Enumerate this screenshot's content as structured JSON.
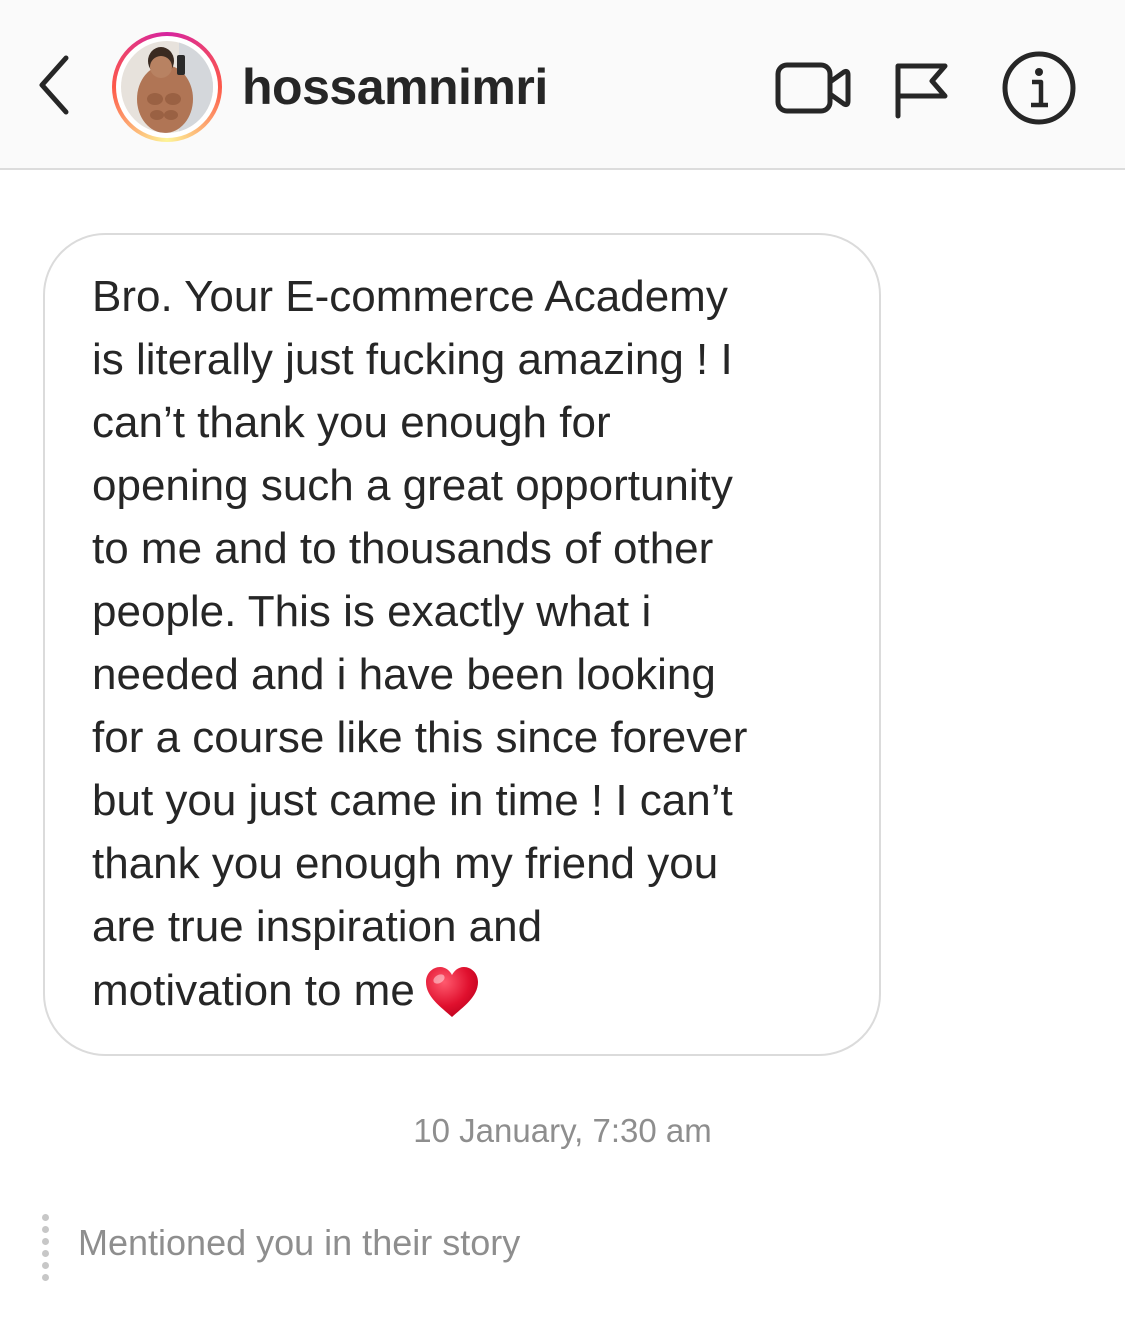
{
  "header": {
    "username": "hossamnimri",
    "icons": {
      "back": "chevron-left-icon",
      "video": "video-camera-icon",
      "report": "flag-icon",
      "info": "info-icon"
    },
    "avatar_ring_colors": [
      "#d6249f",
      "#fd5949",
      "#fdf497"
    ]
  },
  "message": {
    "lines": [
      "Bro. Your E-commerce Academy",
      "is literally just fucking amazing ! I",
      "can’t thank you enough for",
      "opening such a great opportunity",
      "to me and to thousands of other",
      "people. This is exactly what i",
      "needed and i have been looking",
      "for a course like this since forever",
      "but you just came in time ! I can’t",
      "thank you enough my friend you",
      "are true inspiration and",
      "motivation to me"
    ],
    "emoji": "heart-icon",
    "emoji_color": "#e0102e"
  },
  "timestamp": "10 January, 7:30 am",
  "story_mention": "Mentioned you in their story"
}
